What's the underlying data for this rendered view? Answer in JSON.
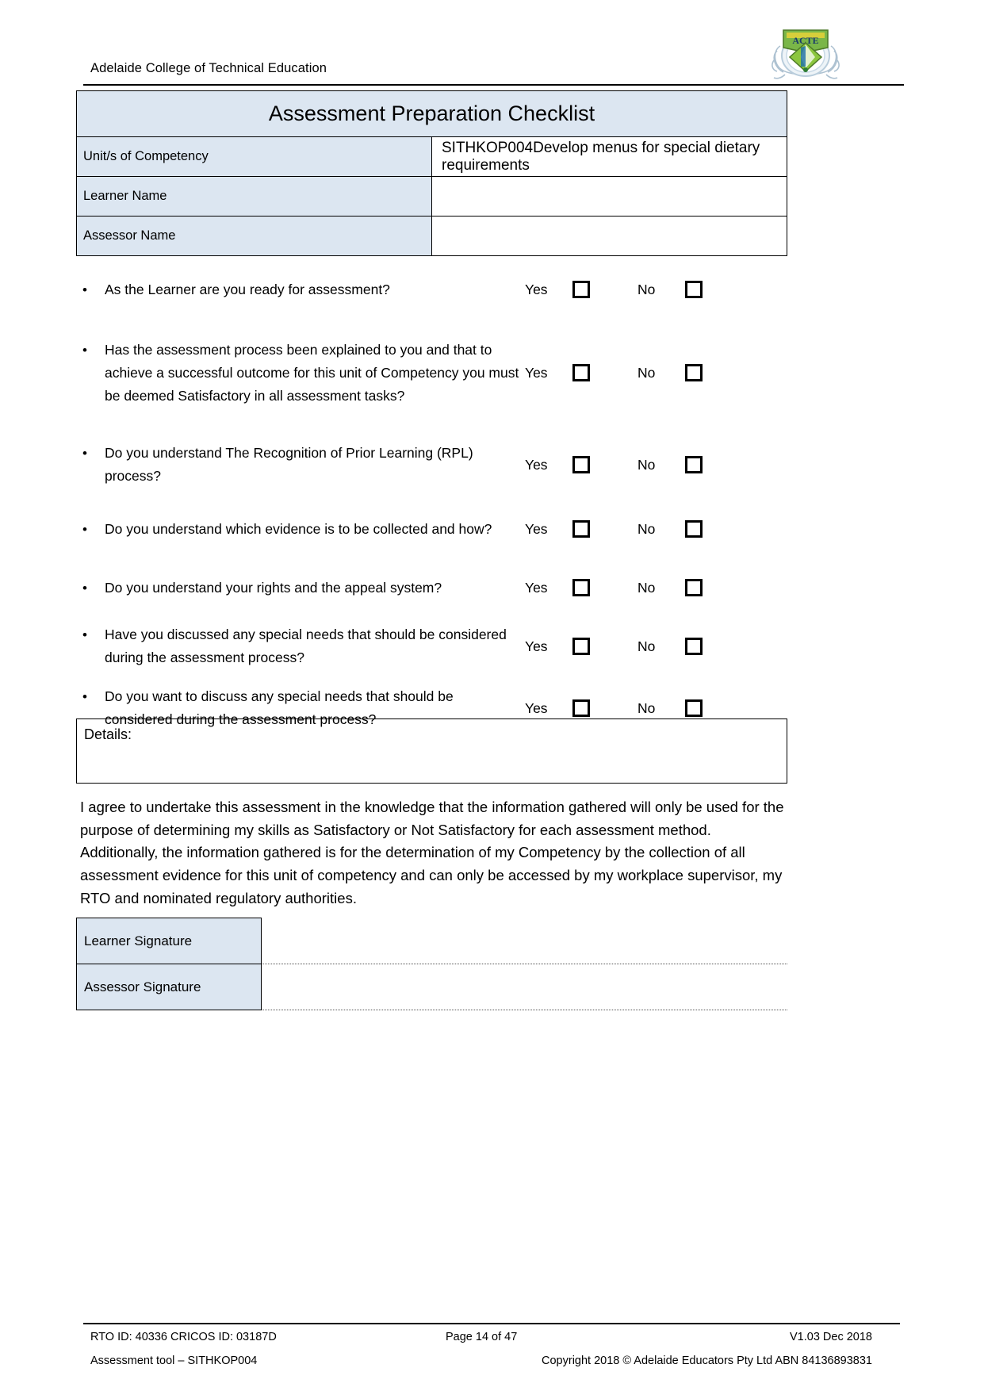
{
  "header": {
    "org_name": "Adelaide College of Technical Education",
    "logo_icon": "college-crest-logo"
  },
  "info_table": {
    "title": "Assessment Preparation Checklist",
    "rows": [
      {
        "label": "Unit/s of Competency",
        "value": "SITHKOP004Develop menus for special dietary requirements"
      },
      {
        "label": "Learner Name",
        "value": ""
      },
      {
        "label": "Assessor Name",
        "value": ""
      }
    ]
  },
  "checklist": {
    "bullet_glyph": "•",
    "yes_label": "Yes",
    "no_label": "No",
    "questions": [
      "As the Learner are you ready for assessment?",
      "Has the assessment process been explained to you and that to achieve a successful outcome for this unit of Competency you must be deemed Satisfactory in all assessment tasks?",
      "Do you understand The Recognition of Prior Learning (RPL) process?",
      "Do you understand which evidence is to be collected and how?",
      "Do you understand your rights and the appeal system?",
      "Have you discussed any special needs that should be considered during the assessment process?",
      "Do you want to discuss any special needs that should be considered during the assessment process?"
    ]
  },
  "details": {
    "label": "Details:",
    "value": ""
  },
  "agreement": {
    "text": "I agree to undertake this assessment in the knowledge that the information gathered will only be used for the purpose of determining my skills as Satisfactory or Not Satisfactory for each assessment method. Additionally, the information gathered is for the determination of my Competency by the collection of all assessment evidence for this unit of competency and can only be accessed by my workplace supervisor, my RTO and nominated regulatory authorities."
  },
  "signatures": {
    "rows": [
      {
        "label": "Learner Signature",
        "value": ""
      },
      {
        "label": "Assessor Signature",
        "value": ""
      }
    ]
  },
  "footer": {
    "rto_line": "RTO ID: 40336 CRICOS ID: 03187D",
    "page_number": "Page 14 of 47",
    "version": "V1.03 Dec 2018",
    "tool_line": "Assessment tool – SITHKOP004",
    "copyright": "Copyright 2018 © Adelaide Educators Pty Ltd ABN 84136893831"
  },
  "colors": {
    "table_header_fill": "#dce6f1",
    "border": "#000000",
    "text": "#000000"
  }
}
